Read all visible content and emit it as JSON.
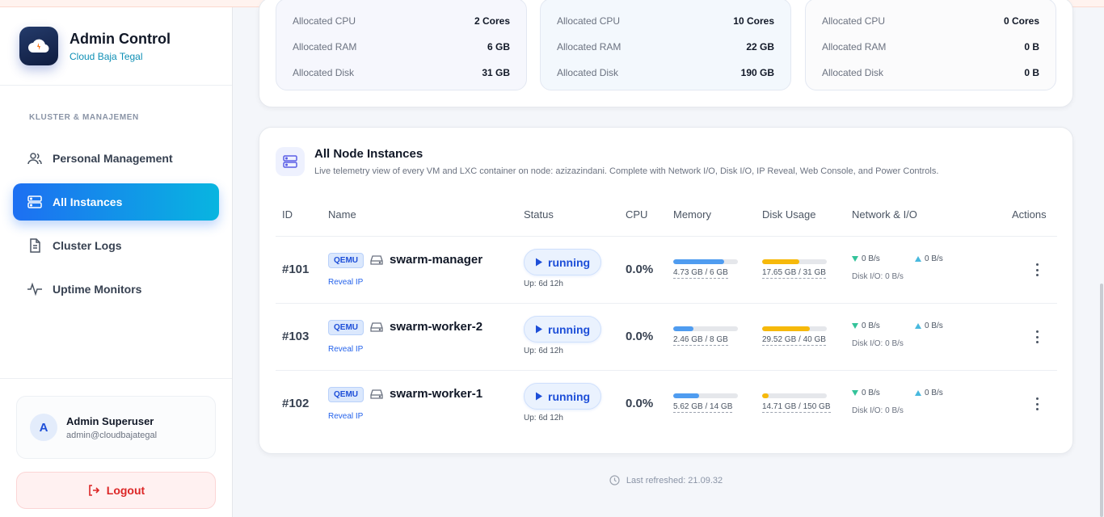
{
  "brand": {
    "title": "Admin Control",
    "subtitle": "Cloud Baja Tegal"
  },
  "sidebar": {
    "section_label": "KLUSTER & MANAJEMEN",
    "items": [
      {
        "label": "Personal Management",
        "icon": "users-icon",
        "active": false
      },
      {
        "label": "All Instances",
        "icon": "server-icon",
        "active": true
      },
      {
        "label": "Cluster Logs",
        "icon": "document-icon",
        "active": false
      },
      {
        "label": "Uptime Monitors",
        "icon": "activity-icon",
        "active": false
      }
    ]
  },
  "user": {
    "initial": "A",
    "name": "Admin Superuser",
    "email": "admin@cloudbajategal"
  },
  "logout_label": "Logout",
  "nodes": [
    {
      "cpu_label": "Allocated CPU",
      "cpu": "2 Cores",
      "ram_label": "Allocated RAM",
      "ram": "6 GB",
      "disk_label": "Allocated Disk",
      "disk": "31 GB"
    },
    {
      "cpu_label": "Allocated CPU",
      "cpu": "10 Cores",
      "ram_label": "Allocated RAM",
      "ram": "22 GB",
      "disk_label": "Allocated Disk",
      "disk": "190 GB"
    },
    {
      "cpu_label": "Allocated CPU",
      "cpu": "0 Cores",
      "ram_label": "Allocated RAM",
      "ram": "0 B",
      "disk_label": "Allocated Disk",
      "disk": "0 B"
    }
  ],
  "instances": {
    "title": "All Node Instances",
    "subtitle": "Live telemetry view of every VM and LXC container on node: azizazindani. Complete with Network I/O, Disk I/O, IP Reveal, Web Console, and Power Controls.",
    "columns": {
      "id": "ID",
      "name": "Name",
      "status": "Status",
      "cpu": "CPU",
      "memory": "Memory",
      "disk": "Disk Usage",
      "network": "Network & I/O",
      "actions": "Actions"
    },
    "rows": [
      {
        "id": "#101",
        "type": "QEMU",
        "name": "swarm-manager",
        "reveal": "Reveal IP",
        "status": "running",
        "uptime": "Up: 6d 12h",
        "cpu": "0.0%",
        "mem_text": "4.73 GB / 6 GB",
        "mem_fraction": 0.79,
        "disk_text": "17.65 GB / 31 GB",
        "disk_fraction": 0.57,
        "net_down": "0 B/s",
        "net_up": "0 B/s",
        "disk_io": "Disk I/O:  0 B/s"
      },
      {
        "id": "#103",
        "type": "QEMU",
        "name": "swarm-worker-2",
        "reveal": "Reveal IP",
        "status": "running",
        "uptime": "Up: 6d 12h",
        "cpu": "0.0%",
        "mem_text": "2.46 GB / 8 GB",
        "mem_fraction": 0.31,
        "disk_text": "29.52 GB / 40 GB",
        "disk_fraction": 0.74,
        "net_down": "0 B/s",
        "net_up": "0 B/s",
        "disk_io": "Disk I/O:  0 B/s"
      },
      {
        "id": "#102",
        "type": "QEMU",
        "name": "swarm-worker-1",
        "reveal": "Reveal IP",
        "status": "running",
        "uptime": "Up: 6d 12h",
        "cpu": "0.0%",
        "mem_text": "5.62 GB / 14 GB",
        "mem_fraction": 0.4,
        "disk_text": "14.71 GB / 150 GB",
        "disk_fraction": 0.1,
        "net_down": "0 B/s",
        "net_up": "0 B/s",
        "disk_io": "Disk I/O:  0 B/s"
      }
    ]
  },
  "last_refreshed": "Last refreshed: 21.09.32",
  "colors": {
    "accent": "#1d6ff2",
    "accent2": "#08b5e0",
    "memory_bar": "#4f9cf0",
    "disk_bar": "#f6b90b",
    "down_arrow": "#34c39a",
    "up_arrow": "#48b9de",
    "logout": "#dc2626"
  }
}
